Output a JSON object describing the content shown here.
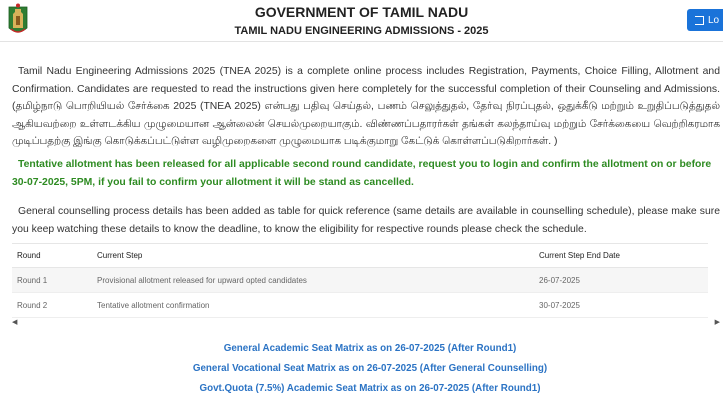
{
  "header": {
    "title": "GOVERNMENT OF TAMIL NADU",
    "subtitle": "TAMIL NADU ENGINEERING ADMISSIONS - 2025",
    "login_label": "Lo"
  },
  "intro": {
    "english": "Tamil Nadu Engineering Admissions 2025 (TNEA 2025) is a complete online process includes Registration, Payments, Choice Filling, Allotment and Confirmation. Candidates are requested to read the instructions given here completely for the successful completion of their Counseling and Admissions. (தமிழ்நாடு பொறியியல் சேர்க்கை 2025 (TNEA 2025) என்பது பதிவு செய்தல், பணம் செலுத்துதல், தேர்வு நிரப்புதல், ஒதுக்கீடு மற்றும் உறுதிப்படுத்துதல் ஆகியவற்றை உள்ளடக்கிய முழுமையான ஆன்லைன் செயல்முறையாகும். விண்ணப்பதாரர்கள் தங்கள் கலந்தாய்வு மற்றும் சேர்க்கையை வெற்றிகரமாக முடிப்பதற்கு இங்கு கொடுக்கப்பட்டுள்ள வழிமுறைகளை முழுமையாக படிக்குமாறு கேட்டுக் கொள்ளப்படுகிறார்கள். )"
  },
  "notice": {
    "text": "Tentative allotment has been released for all applicable second round candidate, request you to login and confirm the allotment on or before 30-07-2025, 5PM, if you fail to confirm your allotment it will be stand as cancelled."
  },
  "counselling": {
    "text": "General counselling process details has been added as table for quick reference (same details are available in counselling schedule), please make sure you keep watching these details to know the deadline, to know the eligibility for respective rounds please check the schedule."
  },
  "table": {
    "headers": [
      "Round",
      "Current Step",
      "Current Step End Date"
    ],
    "rows": [
      [
        "Round 1",
        "Provisional allotment released for upward opted candidates",
        "26-07-2025"
      ],
      [
        "Round 2",
        "Tentative allotment confirmation",
        "30-07-2025"
      ]
    ]
  },
  "links": [
    "General Academic Seat Matrix as on 26-07-2025 (After Round1)",
    "General Vocational Seat Matrix as on 26-07-2025 (After General Counselling)",
    "Govt.Quota (7.5%) Academic Seat Matrix as on 26-07-2025 (After Round1)"
  ],
  "colors": {
    "notice": "#2e8b22",
    "link": "#2b73c4",
    "login_button": "#1a73d9"
  },
  "icons": {
    "emblem": "tamil-nadu-emblem-icon",
    "login": "login-icon",
    "scroll_left": "chevron-left-icon",
    "scroll_right": "chevron-right-icon"
  }
}
